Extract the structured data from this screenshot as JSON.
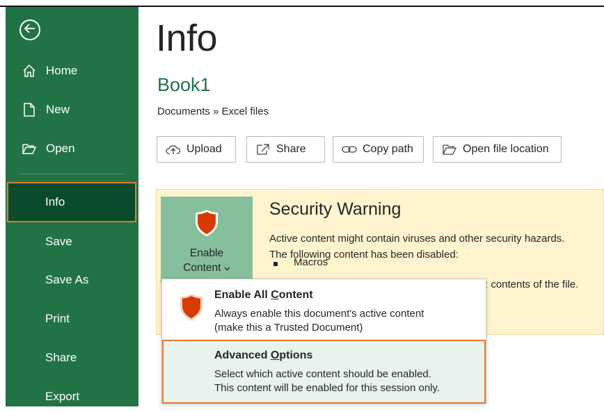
{
  "sidebar": {
    "back_label": "",
    "items": [
      {
        "label": "Home",
        "icon": "home-icon"
      },
      {
        "label": "New",
        "icon": "new-document-icon"
      },
      {
        "label": "Open",
        "icon": "folder-open-icon"
      },
      {
        "label": "Info",
        "active": true
      },
      {
        "label": "Save"
      },
      {
        "label": "Save As"
      },
      {
        "label": "Print"
      },
      {
        "label": "Share"
      },
      {
        "label": "Export"
      }
    ]
  },
  "main": {
    "title": "Info",
    "book_name": "Book1",
    "breadcrumb": "Documents » Excel files",
    "actions": [
      {
        "label": "Upload",
        "icon": "upload-icon"
      },
      {
        "label": "Share",
        "icon": "share-icon"
      },
      {
        "label": "Copy path",
        "icon": "link-icon"
      },
      {
        "label": "Open file location",
        "icon": "folder-icon"
      }
    ]
  },
  "security": {
    "enable_line1": "Enable",
    "enable_line2": "Content",
    "title": "Security Warning",
    "line1": "Active content might contain viruses and other security hazards.",
    "line2": "The following content has been disabled:",
    "bullet": "Macros",
    "trailing": ": contents of the file."
  },
  "dropdown": {
    "items": [
      {
        "title_prefix": "Enable All ",
        "title_mnemonic": "C",
        "title_suffix": "ontent",
        "desc1": "Always enable this document's active content",
        "desc2": "(make this a Trusted Document)"
      },
      {
        "title_prefix": "Advanced ",
        "title_mnemonic": "O",
        "title_suffix": "ptions",
        "desc1": "Select which active content should be enabled.",
        "desc2": "This content will be enabled for this session only."
      }
    ]
  },
  "colors": {
    "sidebar_bg": "#217346",
    "sidebar_active": "#0b4a2a",
    "highlight_border": "#e07b2e",
    "warning_bg": "#fff4ce",
    "enable_btn_bg": "#86bf9c",
    "shield_red": "#d83b01"
  }
}
